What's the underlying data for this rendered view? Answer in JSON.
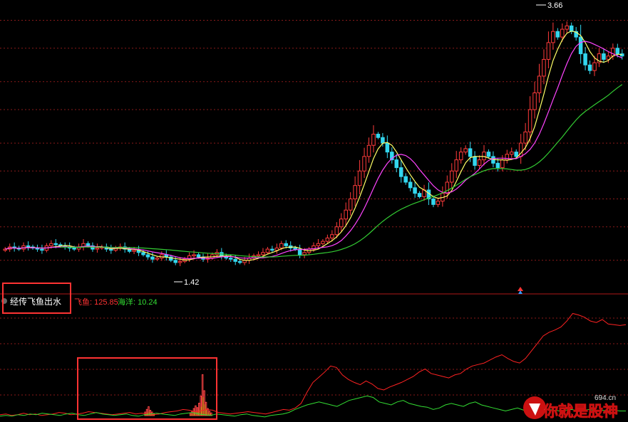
{
  "chart_data": [
    {
      "type": "candlestick",
      "price_high_label": "3.66",
      "price_low_label": "1.42",
      "y_range": [
        1.2,
        3.75
      ],
      "gridlines": [
        1.45,
        1.75,
        2.0,
        2.25,
        2.5,
        2.8,
        3.05,
        3.35,
        3.6
      ],
      "close": [
        1.55,
        1.57,
        1.56,
        1.55,
        1.58,
        1.57,
        1.56,
        1.55,
        1.54,
        1.58,
        1.6,
        1.59,
        1.58,
        1.57,
        1.56,
        1.55,
        1.57,
        1.6,
        1.58,
        1.55,
        1.56,
        1.57,
        1.55,
        1.54,
        1.56,
        1.57,
        1.55,
        1.53,
        1.54,
        1.52,
        1.5,
        1.48,
        1.46,
        1.47,
        1.5,
        1.48,
        1.45,
        1.43,
        1.44,
        1.46,
        1.49,
        1.5,
        1.48,
        1.46,
        1.47,
        1.5,
        1.52,
        1.49,
        1.47,
        1.46,
        1.44,
        1.43,
        1.45,
        1.47,
        1.49,
        1.5,
        1.52,
        1.55,
        1.54,
        1.56,
        1.6,
        1.58,
        1.56,
        1.55,
        1.5,
        1.52,
        1.55,
        1.58,
        1.6,
        1.62,
        1.65,
        1.68,
        1.75,
        1.82,
        1.9,
        2.0,
        2.12,
        2.25,
        2.38,
        2.48,
        2.58,
        2.55,
        2.5,
        2.42,
        2.35,
        2.28,
        2.2,
        2.15,
        2.1,
        2.05,
        2.02,
        2.08,
        2.0,
        1.95,
        1.98,
        2.05,
        2.15,
        2.25,
        2.35,
        2.42,
        2.45,
        2.38,
        2.3,
        2.35,
        2.42,
        2.38,
        2.32,
        2.28,
        2.35,
        2.4,
        2.42,
        2.38,
        2.5,
        2.6,
        2.8,
        2.95,
        3.1,
        3.25,
        3.4,
        3.5,
        3.45,
        3.52,
        3.55,
        3.5,
        3.45,
        3.3,
        3.2,
        3.15,
        3.22,
        3.3,
        3.25,
        3.28,
        3.35,
        3.3,
        3.28
      ],
      "moving_averages": [
        {
          "name": "MA5",
          "color": "#ffff66"
        },
        {
          "name": "MA10",
          "color": "#ff44ff"
        },
        {
          "name": "MA30",
          "color": "#33cc33"
        }
      ]
    },
    {
      "type": "line",
      "indicator_name": "经传飞鱼出水",
      "series": [
        {
          "name": "飞鱼",
          "display_value": "125.85",
          "color": "#ff2222",
          "values": [
            5,
            6,
            4,
            5,
            7,
            5,
            6,
            4,
            5,
            6,
            8,
            7,
            5,
            6,
            7,
            9,
            8,
            7,
            6,
            5,
            6,
            7,
            8,
            6,
            7,
            6,
            5,
            6,
            8,
            9,
            10,
            12,
            11,
            9,
            10,
            12,
            11,
            8,
            7,
            6,
            7,
            8,
            9,
            8,
            7,
            6,
            8,
            10,
            12,
            11,
            14,
            20,
            35,
            48,
            55,
            62,
            70,
            68,
            58,
            52,
            48,
            45,
            50,
            46,
            40,
            38,
            42,
            45,
            48,
            52,
            56,
            62,
            66,
            60,
            58,
            56,
            54,
            58,
            60,
            66,
            70,
            72,
            74,
            78,
            82,
            85,
            80,
            76,
            74,
            80,
            90,
            100,
            110,
            115,
            118,
            122,
            130,
            140,
            138,
            135,
            130,
            128,
            132,
            126,
            125,
            124,
            125
          ]
        },
        {
          "name": "海洋",
          "display_value": "10.24",
          "color": "#33dd33",
          "values": [
            3,
            4,
            3,
            5,
            4,
            6,
            5,
            7,
            6,
            5,
            4,
            6,
            7,
            5,
            4,
            6,
            8,
            6,
            5,
            4,
            5,
            6,
            4,
            3,
            5,
            6,
            7,
            6,
            5,
            4,
            6,
            7,
            8,
            6,
            5,
            4,
            6,
            5,
            4,
            3,
            5,
            6,
            4,
            3,
            2,
            4,
            5,
            6,
            8,
            12,
            15,
            18,
            20,
            22,
            20,
            18,
            16,
            20,
            24,
            26,
            28,
            30,
            28,
            22,
            20,
            18,
            22,
            24,
            20,
            18,
            16,
            15,
            12,
            14,
            18,
            20,
            18,
            16,
            20,
            22,
            18,
            16,
            14,
            12,
            10,
            12,
            14,
            11,
            10,
            12,
            13,
            12,
            11,
            10,
            11,
            12,
            10,
            11,
            12,
            10,
            11,
            10,
            11,
            10,
            10
          ]
        }
      ],
      "histogram": [
        0,
        0,
        0,
        0,
        0,
        0,
        0,
        0,
        0,
        0,
        0,
        0,
        0,
        0,
        0,
        0,
        0,
        0,
        0,
        0,
        0,
        0,
        0,
        0,
        0,
        0,
        0,
        0,
        0,
        0,
        0,
        0,
        0,
        0,
        0,
        0,
        0,
        4,
        7,
        10,
        6,
        4,
        2,
        0,
        0,
        0,
        0,
        0,
        0,
        0,
        0,
        0,
        0,
        0,
        0,
        0,
        0,
        0,
        0,
        0,
        0,
        0,
        0,
        3,
        5,
        8,
        11,
        9,
        14,
        22,
        46,
        28,
        15,
        8,
        5,
        3,
        0
      ]
    }
  ],
  "logo": {
    "text": "你就是股神",
    "site": "694.cn"
  }
}
